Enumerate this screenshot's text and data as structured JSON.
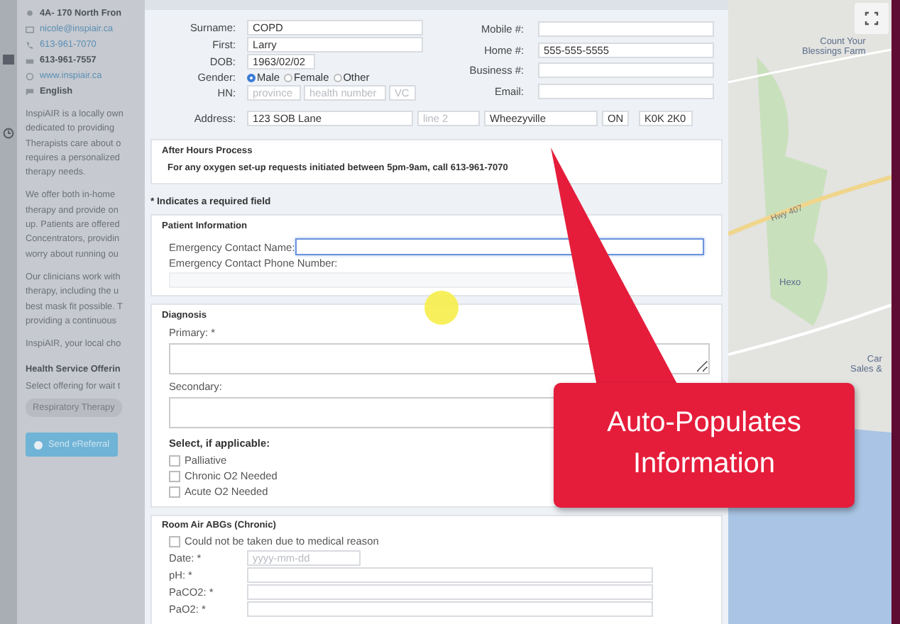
{
  "sidebar": {
    "contacts": [
      {
        "kind": "address",
        "text": "4A- 170 North Fron"
      },
      {
        "kind": "email",
        "text": "nicole@inspiair.ca"
      },
      {
        "kind": "phone",
        "text": "613-961-7070"
      },
      {
        "kind": "fax",
        "text": "613-961-7557"
      },
      {
        "kind": "web",
        "text": "www.inspiair.ca"
      },
      {
        "kind": "language",
        "text": "English"
      }
    ],
    "paragraphs": [
      "InspiAIR is a locally own\ndedicated to providing\nTherapists care about o\nrequires a personalized\ntherapy needs.",
      "We offer both in-home\ntherapy and provide on\nup. Patients are offered\nConcentrators, providin\nworry about running ou",
      "Our clinicians work with\ntherapy, including the u\nbest mask fit possible. T\nproviding a continuous",
      "InspiAIR, your local cho"
    ],
    "offerings_heading": "Health Service Offerin",
    "offerings_hint": "Select offering for wait t",
    "offering": "Respiratory Therapy",
    "send_button": "Send eReferral"
  },
  "personal": {
    "left_fields": [
      {
        "label": "Surname:",
        "value": "COPD"
      },
      {
        "label": "First:",
        "value": "Larry"
      },
      {
        "label": "DOB:",
        "value": "1963/02/02",
        "kind": "short"
      }
    ],
    "gender": {
      "label": "Gender:",
      "options": [
        {
          "label": "Male",
          "selected": true
        },
        {
          "label": "Female",
          "selected": false
        },
        {
          "label": "Other",
          "selected": false
        }
      ]
    },
    "hn": {
      "label": "HN:",
      "fields": [
        {
          "placeholder": "province"
        },
        {
          "placeholder": "health number"
        },
        {
          "placeholder": "VC"
        }
      ]
    },
    "right_fields": [
      {
        "label": "Mobile #:"
      },
      {
        "label": "Home #:",
        "value": "555-555-5555"
      },
      {
        "label": "Business #:"
      },
      {
        "label": "Email:"
      }
    ],
    "address": {
      "label": "Address:",
      "fields": [
        {
          "value": "123 SOB Lane"
        },
        {
          "placeholder": "line 2"
        },
        {
          "value": "Wheezyville"
        },
        {
          "value": "ON"
        },
        {
          "value": "K0K 2K0"
        }
      ]
    }
  },
  "after_hours": {
    "title": "After Hours Process",
    "text": "For any oxygen set-up requests initiated between 5pm-9am, call 613-961-7070"
  },
  "required_note": "* Indicates a required field",
  "patient_info": {
    "title": "Patient Information",
    "fields": [
      {
        "label": "Emergency Contact Name:",
        "kind": "inline",
        "focused": true
      },
      {
        "label": "Emergency Contact Phone Number:",
        "kind": "stacked",
        "focused": false
      }
    ]
  },
  "diagnosis": {
    "title": "Diagnosis",
    "fields": [
      {
        "label": "Primary: *"
      },
      {
        "label": "Secondary:"
      }
    ],
    "select_label": "Select, if applicable:",
    "checkboxes": [
      {
        "label": "Palliative",
        "checked": false
      },
      {
        "label": "Chronic O2 Needed",
        "checked": false
      },
      {
        "label": "Acute O2 Needed",
        "checked": false
      }
    ]
  },
  "abgs": {
    "title": "Room Air ABGs (Chronic)",
    "checkbox": {
      "label": "Could not be taken due to medical reason",
      "checked": false
    },
    "fields": [
      {
        "label": "Date: *",
        "placeholder": "yyyy-mm-dd",
        "kind": "date"
      },
      {
        "label": "pH: *",
        "kind": "text"
      },
      {
        "label": "PaCO2: *",
        "kind": "text"
      },
      {
        "label": "PaO2: *",
        "kind": "text"
      }
    ]
  },
  "map": {
    "labels": [
      {
        "kind": "place",
        "text": "Count Your\nBlessings Farm"
      },
      {
        "kind": "road",
        "text": "Hwy 407"
      },
      {
        "kind": "place",
        "text": "Hexo"
      },
      {
        "kind": "place",
        "text": "Car\nSales &"
      }
    ]
  },
  "callout": {
    "text": "Auto-Populates Information"
  }
}
